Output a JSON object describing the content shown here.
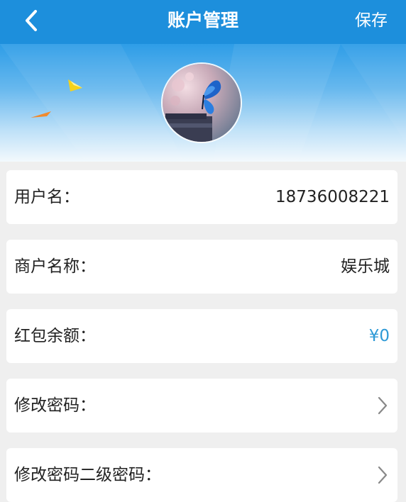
{
  "header": {
    "title": "账户管理",
    "save_label": "保存",
    "back_icon": "chevron-left-icon",
    "background_color": "#1d8fdc"
  },
  "profile": {
    "avatar_image": "butterfly-avatar"
  },
  "fields": [
    {
      "label": "用户名：",
      "value": "18736008221"
    },
    {
      "label": "商户名称：",
      "value": "娱乐城"
    },
    {
      "label": "红包余额：",
      "value": "¥0",
      "value_color": "#2e9ad6"
    },
    {
      "label": "修改密码：",
      "icon": "chevron-right-icon"
    },
    {
      "label": "修改密码二级密码：",
      "icon": "chevron-right-icon"
    }
  ]
}
